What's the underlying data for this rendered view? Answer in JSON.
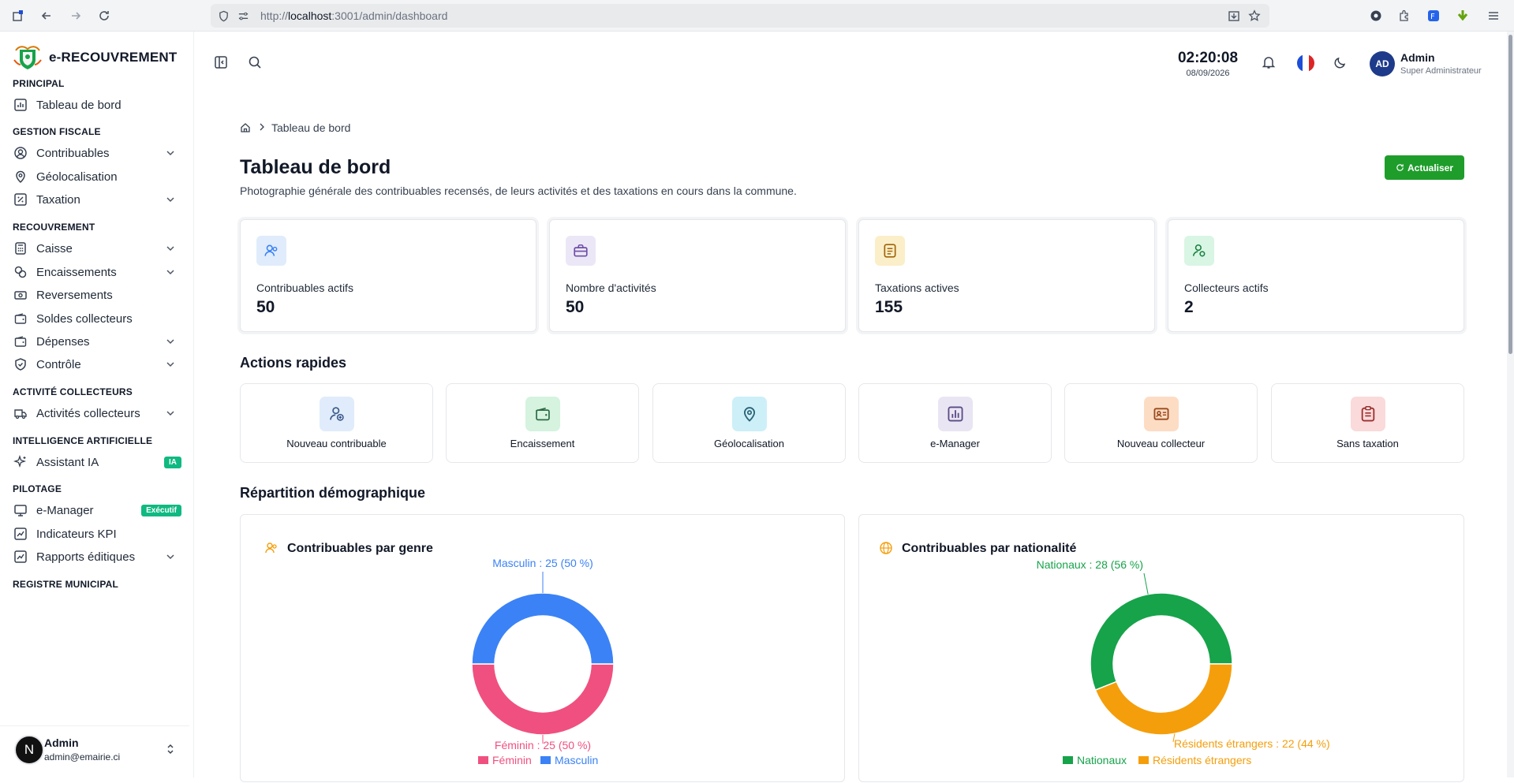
{
  "browser": {
    "url_prefix": "http://",
    "url_host": "localhost",
    "url_path": ":3001/admin/dashboard"
  },
  "app": {
    "name": "e-RECOUVREMENT"
  },
  "sidebar": {
    "sections": [
      {
        "title": "PRINCIPAL",
        "items": [
          {
            "label": "Tableau de bord",
            "icon": "dashboard-icon"
          }
        ]
      },
      {
        "title": "GESTION FISCALE",
        "items": [
          {
            "label": "Contribuables",
            "icon": "user-circle-icon",
            "expandable": true
          },
          {
            "label": "Géolocalisation",
            "icon": "map-pin-icon"
          },
          {
            "label": "Taxation",
            "icon": "percent-icon",
            "expandable": true
          }
        ]
      },
      {
        "title": "RECOUVREMENT",
        "items": [
          {
            "label": "Caisse",
            "icon": "calculator-icon",
            "expandable": true
          },
          {
            "label": "Encaissements",
            "icon": "coins-icon",
            "expandable": true
          },
          {
            "label": "Reversements",
            "icon": "banknote-icon"
          },
          {
            "label": "Soldes collecteurs",
            "icon": "wallet-icon"
          },
          {
            "label": "Dépenses",
            "icon": "wallet-icon",
            "expandable": true
          },
          {
            "label": "Contrôle",
            "icon": "shield-check-icon",
            "expandable": true
          }
        ]
      },
      {
        "title": "ACTIVITÉ COLLECTEURS",
        "items": [
          {
            "label": "Activités collecteurs",
            "icon": "truck-icon",
            "expandable": true
          }
        ]
      },
      {
        "title": "INTELLIGENCE ARTIFICIELLE",
        "items": [
          {
            "label": "Assistant IA",
            "icon": "sparkles-icon",
            "badge": "IA"
          }
        ]
      },
      {
        "title": "PILOTAGE",
        "items": [
          {
            "label": "e-Manager",
            "icon": "monitor-icon",
            "badge": "Exécutif"
          },
          {
            "label": "Indicateurs KPI",
            "icon": "trend-chart-icon"
          },
          {
            "label": "Rapports éditiques",
            "icon": "trend-chart-icon",
            "expandable": true
          }
        ]
      },
      {
        "title": "REGISTRE MUNICIPAL",
        "items": []
      }
    ],
    "footer": {
      "avatar": "N",
      "name": "Admin",
      "email": "admin@emairie.ci"
    }
  },
  "topbar": {
    "time": "02:20:08",
    "date": "08/09/2026",
    "user_initials": "AD",
    "user_name": "Admin",
    "user_role": "Super Administrateur"
  },
  "breadcrumb": {
    "current": "Tableau de bord"
  },
  "page": {
    "title": "Tableau de bord",
    "subtitle": "Photographie générale des contribuables recensés, de leurs activités et des taxations en cours dans la commune.",
    "refresh_label": "Actualiser"
  },
  "stats": [
    {
      "label": "Contribuables actifs",
      "value": "50",
      "icon": "users-icon",
      "bg": "#e0ecfb",
      "fg": "#3b82f6"
    },
    {
      "label": "Nombre d'activités",
      "value": "50",
      "icon": "briefcase-icon",
      "bg": "#ece7f6",
      "fg": "#6d4fa8"
    },
    {
      "label": "Taxations actives",
      "value": "155",
      "icon": "document-icon",
      "bg": "#fbefc9",
      "fg": "#a16207"
    },
    {
      "label": "Collecteurs actifs",
      "value": "2",
      "icon": "user-pin-icon",
      "bg": "#d9f5e4",
      "fg": "#15803d"
    }
  ],
  "quick_actions": {
    "title": "Actions rapides",
    "items": [
      {
        "label": "Nouveau contribuable",
        "icon": "user-plus-icon",
        "bg": "#e0ecfb",
        "fg": "#3b5b8a"
      },
      {
        "label": "Encaissement",
        "icon": "wallet-icon",
        "bg": "#d5f3df",
        "fg": "#2f6b46"
      },
      {
        "label": "Géolocalisation",
        "icon": "map-pin-icon",
        "bg": "#cdeff8",
        "fg": "#2b6476"
      },
      {
        "label": "e-Manager",
        "icon": "bar-chart-icon",
        "bg": "#e9e5f3",
        "fg": "#5b4b86"
      },
      {
        "label": "Nouveau collecteur",
        "icon": "id-card-icon",
        "bg": "#fddcc4",
        "fg": "#9a4a1c"
      },
      {
        "label": "Sans taxation",
        "icon": "clipboard-icon",
        "bg": "#fadada",
        "fg": "#9b3030"
      }
    ]
  },
  "demographics": {
    "title": "Répartition démographique",
    "charts": [
      {
        "title": "Contribuables par genre",
        "icon": "users-icon",
        "chart_data": {
          "type": "pie",
          "donut": true,
          "categories": [
            "Féminin",
            "Masculin"
          ],
          "values": [
            25,
            25
          ],
          "colors": [
            "#f0507f",
            "#3b82f6"
          ],
          "data_labels": [
            "Féminin : 25 (50 %)",
            "Masculin : 25 (50 %)"
          ],
          "legend": "bottom"
        }
      },
      {
        "title": "Contribuables par nationalité",
        "icon": "globe-icon",
        "chart_data": {
          "type": "pie",
          "donut": true,
          "categories": [
            "Nationaux",
            "Résidents étrangers"
          ],
          "values": [
            28,
            22
          ],
          "colors": [
            "#16a34a",
            "#f59e0b"
          ],
          "data_labels": [
            "Nationaux : 28 (56 %)",
            "Résidents étrangers : 22 (44 %)"
          ],
          "legend": "bottom"
        }
      }
    ]
  }
}
